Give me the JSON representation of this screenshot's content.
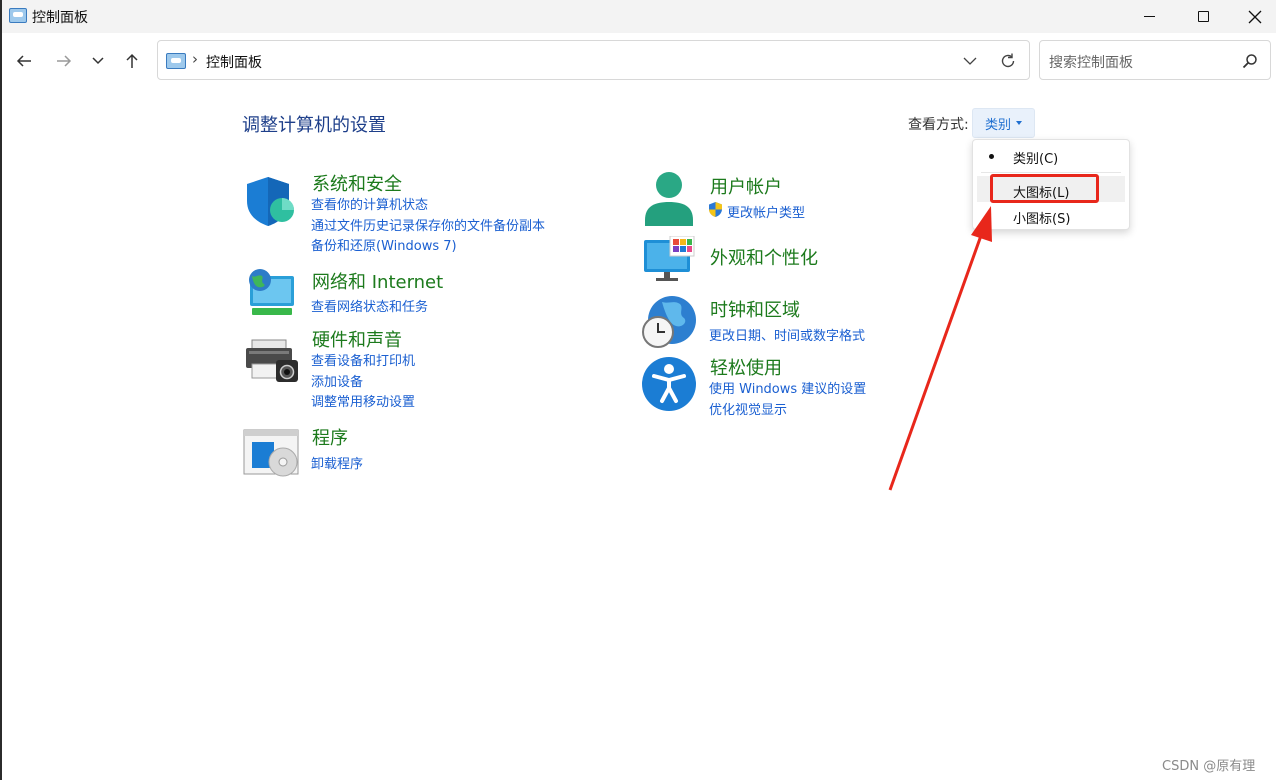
{
  "window": {
    "title": "控制面板"
  },
  "address": {
    "separator": "›",
    "path": "控制面板"
  },
  "search": {
    "placeholder": "搜索控制面板"
  },
  "page": {
    "title": "调整计算机的设置",
    "view_by_label": "查看方式:",
    "view_by_value": "类别"
  },
  "categories": {
    "system_security": {
      "title": "系统和安全",
      "links": [
        "查看你的计算机状态",
        "通过文件历史记录保存你的文件备份副本",
        "备份和还原(Windows 7)"
      ]
    },
    "network": {
      "title": "网络和 Internet",
      "links": [
        "查看网络状态和任务"
      ]
    },
    "hardware": {
      "title": "硬件和声音",
      "links": [
        "查看设备和打印机",
        "添加设备",
        "调整常用移动设置"
      ]
    },
    "programs": {
      "title": "程序",
      "links": [
        "卸载程序"
      ]
    },
    "user_accounts": {
      "title": "用户帐户",
      "links": [
        "更改帐户类型"
      ]
    },
    "appearance": {
      "title": "外观和个性化",
      "links": []
    },
    "clock_region": {
      "title": "时钟和区域",
      "links": [
        "更改日期、时间或数字格式"
      ]
    },
    "ease_of_access": {
      "title": "轻松使用",
      "links": [
        "使用 Windows 建议的设置",
        "优化视觉显示"
      ]
    }
  },
  "view_menu": {
    "items": [
      "类别(C)",
      "大图标(L)",
      "小图标(S)"
    ],
    "selected": "类别(C)",
    "highlighted": "大图标(L)"
  },
  "annotation": {
    "box_color": "#e8271b",
    "arrow_color": "#e8271b"
  },
  "watermark": "CSDN @原有理",
  "colors": {
    "category_title": "#1c7a1c",
    "link": "#1a5fd1",
    "page_title": "#1e3f8a"
  }
}
